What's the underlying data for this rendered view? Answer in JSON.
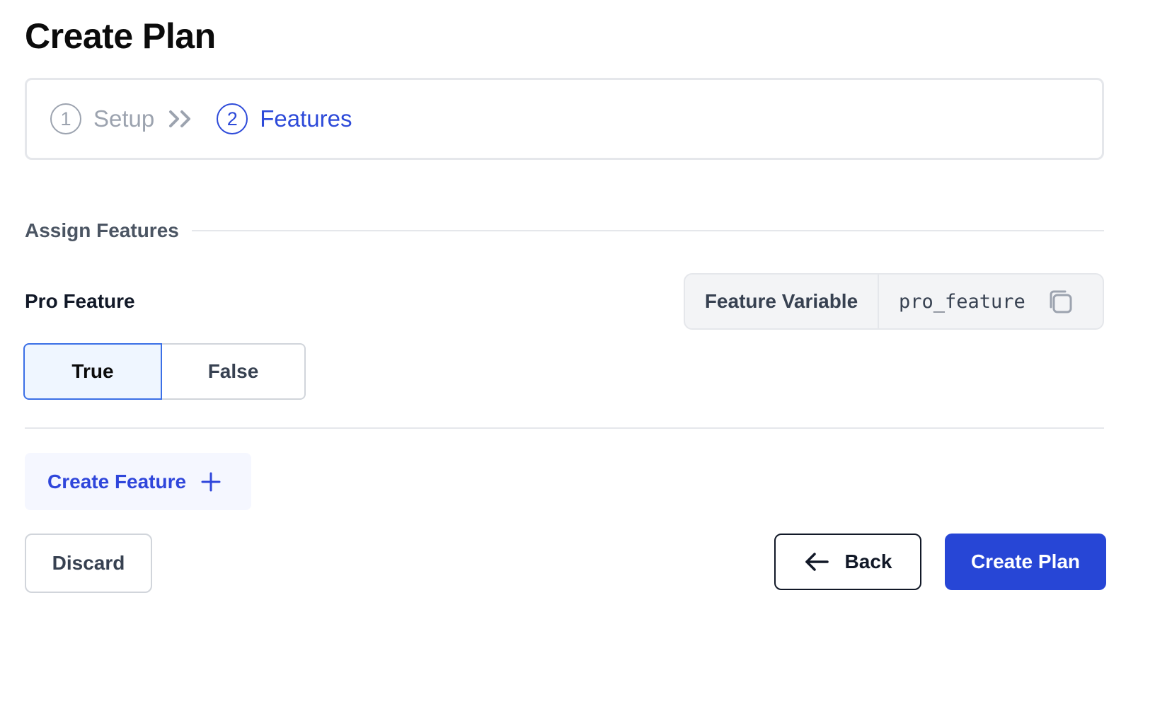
{
  "header": {
    "title": "Create Plan"
  },
  "stepper": {
    "steps": [
      {
        "number": "1",
        "label": "Setup",
        "state": "inactive"
      },
      {
        "number": "2",
        "label": "Features",
        "state": "active"
      }
    ],
    "separator_icon": "double-chevron-right-icon"
  },
  "section": {
    "title": "Assign Features"
  },
  "feature": {
    "name": "Pro Feature",
    "variable_label": "Feature Variable",
    "variable_value": "pro_feature",
    "copy_icon": "copy-icon",
    "options": [
      "True",
      "False"
    ],
    "selected": "True"
  },
  "actions": {
    "create_feature": "Create Feature",
    "create_feature_icon": "plus-icon",
    "discard": "Discard",
    "back": "Back",
    "back_icon": "arrow-left-icon",
    "create_plan": "Create Plan"
  },
  "colors": {
    "accent": "#2746d6",
    "active_step": "#2d4ad9",
    "inactive_step": "#9ca3af",
    "selected_toggle_bg": "#eff6ff",
    "selected_toggle_border": "#3b6fe6"
  }
}
